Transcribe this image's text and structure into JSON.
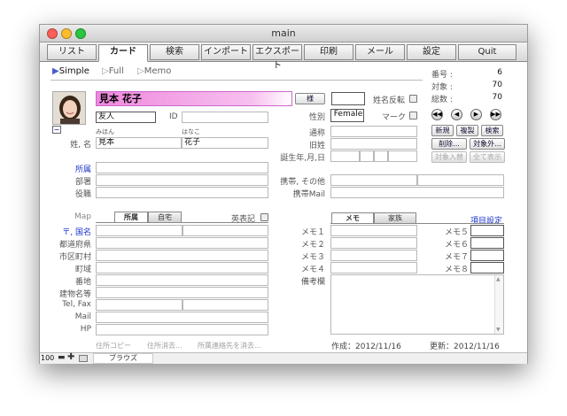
{
  "window": {
    "title": "main"
  },
  "tabs": [
    "リスト",
    "カード",
    "検索",
    "インポート",
    "エクスポート",
    "印刷",
    "メール",
    "設定",
    "Quit"
  ],
  "view_modes": [
    {
      "label": "Simple"
    },
    {
      "label": "Full"
    },
    {
      "label": "Memo"
    }
  ],
  "stats": {
    "number_label": "番号 :",
    "number_value": "6",
    "target_label": "対象 :",
    "target_value": "70",
    "total_label": "総数 :",
    "total_value": "70"
  },
  "name_block": {
    "display_name": "見本 花子",
    "honorific": "様",
    "honorific_extra": "",
    "sei_mei_swap_label": "姓名反転",
    "relation": "友人",
    "id_label": "ID",
    "id_value": "",
    "sei_kana": "みほん",
    "mei_kana": "はなこ",
    "name_label": "姓, 名",
    "sei": "見本",
    "mei": "花子",
    "minus": "−"
  },
  "right_info": {
    "gender_label": "性別",
    "gender_value": "Female",
    "mark_label": "マーク",
    "alias_label": "通称",
    "alias_value": "",
    "old_name_label": "旧姓",
    "old_name_value": "",
    "birthday_label": "誕生年,月,日",
    "mobile_label": "携帯, その他",
    "mobile_mail_label": "携帯Mail"
  },
  "nav_buttons": [
    "◀◀",
    "◀",
    "▶",
    "▶▶"
  ],
  "action_buttons": {
    "new": "新規",
    "duplicate": "複製",
    "search": "検索",
    "delete": "削除...",
    "exclude": "対象外...",
    "add_target": "対象入替",
    "show_all": "全て表示"
  },
  "org": {
    "affiliation_label": "所属",
    "department_label": "部署",
    "position_label": "役職"
  },
  "address": {
    "map_label": "Map",
    "tab_work": "所属",
    "tab_home": "自宅",
    "english_label": "英表記",
    "rows": [
      "〒, 国名",
      "都道府県",
      "市区町村",
      "町域",
      "番地",
      "建物名等",
      "Tel, Fax",
      "Mail",
      "HP"
    ],
    "links": [
      "住所コピー",
      "住所消去...",
      "所属連絡先を消去..."
    ]
  },
  "memo": {
    "tab_memo": "メモ",
    "tab_family": "家族",
    "settings_link": "項目設定",
    "left_labels": [
      "メモ１",
      "メモ２",
      "メモ３",
      "メモ４"
    ],
    "right_labels": [
      "メモ５",
      "メモ６",
      "メモ７",
      "メモ８"
    ],
    "remarks_label": "備考欄",
    "created": "作成：2012/11/16",
    "updated": "更新：2012/11/16"
  },
  "status_bar": {
    "zoom": "100",
    "mode": "ブラウズ"
  },
  "colors": {
    "name_highlight": "#ee88dd",
    "link_blue": "#1a33cc"
  }
}
